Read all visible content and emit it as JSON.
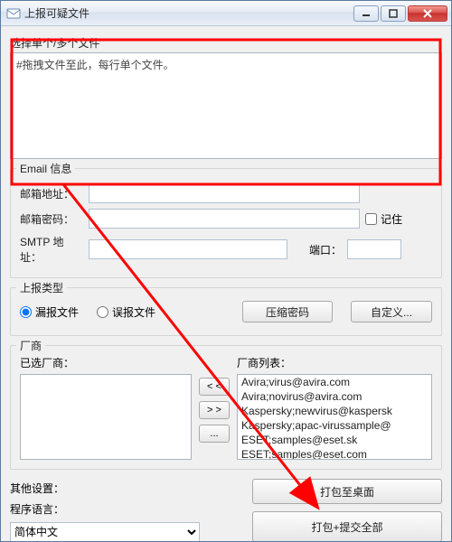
{
  "titlebar": {
    "title": "上报可疑文件"
  },
  "files": {
    "section_label": "选择单个/多个文件",
    "textarea_text": "#拖拽文件至此，每行单个文件。"
  },
  "email": {
    "legend": "Email 信息",
    "address_label": "邮箱地址：",
    "password_label": "邮箱密码：",
    "remember_label": "记住",
    "smtp_label": "SMTP 地址：",
    "port_label": "端口："
  },
  "report": {
    "legend": "上报类型",
    "missed_label": "漏报文件",
    "false_label": "误报文件",
    "zip_pw_btn": "压缩密码",
    "custom_btn": "自定义..."
  },
  "vendor": {
    "legend": "厂商",
    "selected_label": "已选厂商：",
    "list_label": "厂商列表：",
    "move_left": "< <",
    "move_right": "> >",
    "more": "...",
    "items": [
      "Avira;virus@avira.com",
      "Avira;novirus@avira.com",
      "Kaspersky;newvirus@kaspersk",
      "Kaspersky;apac-virussample@",
      "ESET;samples@eset.sk",
      "ESET;samples@eset.com"
    ]
  },
  "footer": {
    "other_label": "其他设置：",
    "lang_label": "程序语言：",
    "lang_value": "简体中文",
    "pack_desktop_btn": "打包至桌面",
    "pack_submit_btn": "打包+提交全部"
  },
  "annotation": {
    "rect_color": "#ff0000",
    "arrow_color": "#ff0000"
  }
}
